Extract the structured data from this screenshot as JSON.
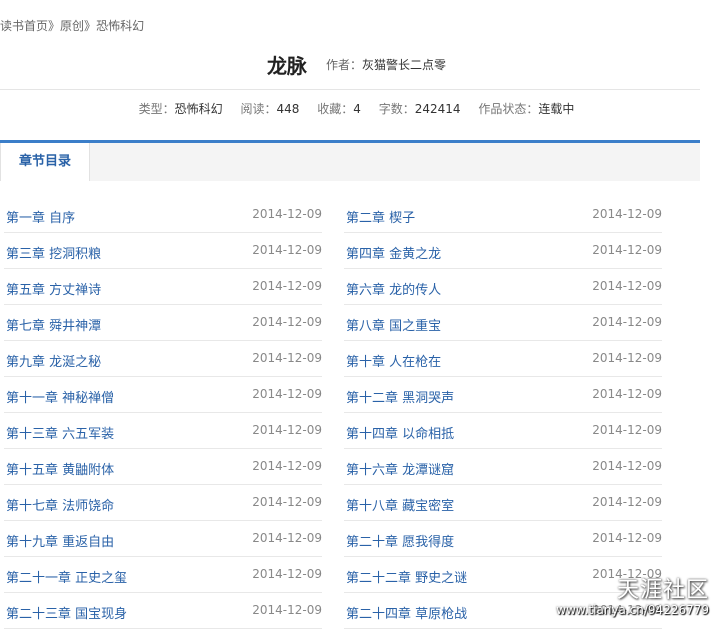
{
  "breadcrumb": {
    "home": "读书首页",
    "sep1": "》",
    "original": "原创",
    "sep2": "》",
    "category": "恐怖科幻"
  },
  "book": {
    "title": "龙脉",
    "author_label": "作者：",
    "author_name": "灰猫警长二点零"
  },
  "meta": {
    "type_label": "类型：",
    "type_value": "恐怖科幻",
    "reads_label": "阅读：",
    "reads_value": "448",
    "favorites_label": "收藏：",
    "favorites_value": "4",
    "words_label": "字数：",
    "words_value": "242414",
    "status_label": "作品状态：",
    "status_value": "连载中"
  },
  "tabs": {
    "toc_label": "章节目录"
  },
  "chapters_left": [
    {
      "title": "第一章 自序",
      "date": "2014-12-09"
    },
    {
      "title": "第三章 挖洞积粮",
      "date": "2014-12-09"
    },
    {
      "title": "第五章 方丈禅诗",
      "date": "2014-12-09"
    },
    {
      "title": "第七章 舜井神潭",
      "date": "2014-12-09"
    },
    {
      "title": "第九章 龙涎之秘",
      "date": "2014-12-09"
    },
    {
      "title": "第十一章 神秘禅僧",
      "date": "2014-12-09"
    },
    {
      "title": "第十三章 六五军装",
      "date": "2014-12-09"
    },
    {
      "title": "第十五章 黄鼬附体",
      "date": "2014-12-09"
    },
    {
      "title": "第十七章 法师饶命",
      "date": "2014-12-09"
    },
    {
      "title": "第十九章 重返自由",
      "date": "2014-12-09"
    },
    {
      "title": "第二十一章 正史之玺",
      "date": "2014-12-09"
    },
    {
      "title": "第二十三章 国宝现身",
      "date": "2014-12-09"
    }
  ],
  "chapters_right": [
    {
      "title": "第二章 楔子",
      "date": "2014-12-09"
    },
    {
      "title": "第四章 金黄之龙",
      "date": "2014-12-09"
    },
    {
      "title": "第六章 龙的传人",
      "date": "2014-12-09"
    },
    {
      "title": "第八章 国之重宝",
      "date": "2014-12-09"
    },
    {
      "title": "第十章 人在枪在",
      "date": "2014-12-09"
    },
    {
      "title": "第十二章 黑洞哭声",
      "date": "2014-12-09"
    },
    {
      "title": "第十四章 以命相抵",
      "date": "2014-12-09"
    },
    {
      "title": "第十六章 龙潭谜窟",
      "date": "2014-12-09"
    },
    {
      "title": "第十八章 藏宝密室",
      "date": "2014-12-09"
    },
    {
      "title": "第二十章 愿我得度",
      "date": "2014-12-09"
    },
    {
      "title": "第二十二章 野史之谜",
      "date": "2014-12-09"
    },
    {
      "title": "第二十四章 草原枪战",
      "date": "2014-12-09"
    }
  ],
  "watermark": {
    "logo": "天涯社区",
    "url": "www.tianya.cn/94226779"
  },
  "colors": {
    "link": "#2a62a8",
    "accent": "#3b7ec9"
  }
}
